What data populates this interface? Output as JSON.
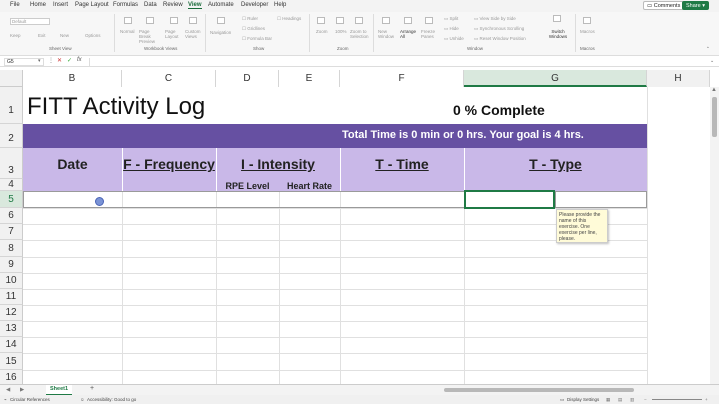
{
  "menu": [
    "File",
    "Home",
    "Insert",
    "Page Layout",
    "Formulas",
    "Data",
    "Review",
    "View",
    "Automate",
    "Developer",
    "Help"
  ],
  "menu_active": "View",
  "comments_label": "Comments",
  "share_label": "Share",
  "ribbon": {
    "sheet_view": [
      "Default",
      "Keep",
      "Exit",
      "New",
      "Options"
    ],
    "workbook_views": [
      "Normal",
      "Page Break Preview",
      "Page Layout",
      "Custom Views"
    ],
    "show": [
      "Navigation",
      "Ruler",
      "Gridlines",
      "Formula Bar",
      "Headings"
    ],
    "zoom": [
      "Zoom",
      "100%",
      "Zoom to Selection"
    ],
    "window": [
      "New Window",
      "Arrange All",
      "Freeze Panes",
      "Split",
      "Hide",
      "Unhide",
      "View Side by Side",
      "Synchronous Scrolling",
      "Reset Window Position",
      "Switch Windows"
    ],
    "macros": [
      "Macros"
    ],
    "groups": [
      "Sheet View",
      "Workbook Views",
      "Show",
      "Zoom",
      "Window",
      "Macros"
    ]
  },
  "name_box": "G5",
  "fx": "fx",
  "columns": [
    "B",
    "C",
    "D",
    "E",
    "F",
    "G",
    "H"
  ],
  "rows": [
    "1",
    "2",
    "3",
    "4",
    "5",
    "6",
    "7",
    "8",
    "9",
    "10",
    "11",
    "12",
    "13",
    "14",
    "15",
    "16"
  ],
  "sheet": {
    "title": "FITT Activity Log",
    "complete": "0 % Complete",
    "total_time": "Total Time is 0 min or 0 hrs. Your goal is 4 hrs.",
    "headers": {
      "date": "Date",
      "frequency": "F - Frequency",
      "intensity": "I - Intensity",
      "time": "T - Time",
      "type": "T - Type"
    },
    "sub_headers": {
      "rpe": "RPE Level",
      "heart_rate": "Heart Rate"
    }
  },
  "tooltip": "Please provide the name of this exercise. One exercise per line, please.",
  "sheet_tab": "Sheet1",
  "add_sheet": "+",
  "status": {
    "circular": "Circular References",
    "accessibility": "Accessibility: Good to go",
    "display": "Display Settings"
  },
  "colors": {
    "purple_dark": "#6650a2",
    "purple_light": "#c9b8e8",
    "accent_green": "#1f7a45"
  }
}
